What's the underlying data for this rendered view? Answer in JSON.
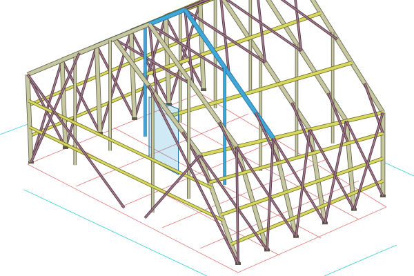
{
  "viewport": {
    "background": "#ffffff",
    "view": "isometric"
  },
  "colors": {
    "grid_cyan": "#40d0d8",
    "grid_red": "#e07878",
    "column": "#c8c8a0",
    "column_dark": "#5a5a48",
    "purlin": "#d8d860",
    "purlin_dark": "#6a6a20",
    "bracing": "#a07888",
    "bracing_dark": "#4a3040",
    "highlight": "#40a8d8",
    "highlight_dark": "#1e6a98",
    "outline": "#222222"
  },
  "model": {
    "type": "steel-frame-building",
    "roof": "gable",
    "frames": 6,
    "columns_per_frame": 4,
    "selected_frame_index": 2
  }
}
